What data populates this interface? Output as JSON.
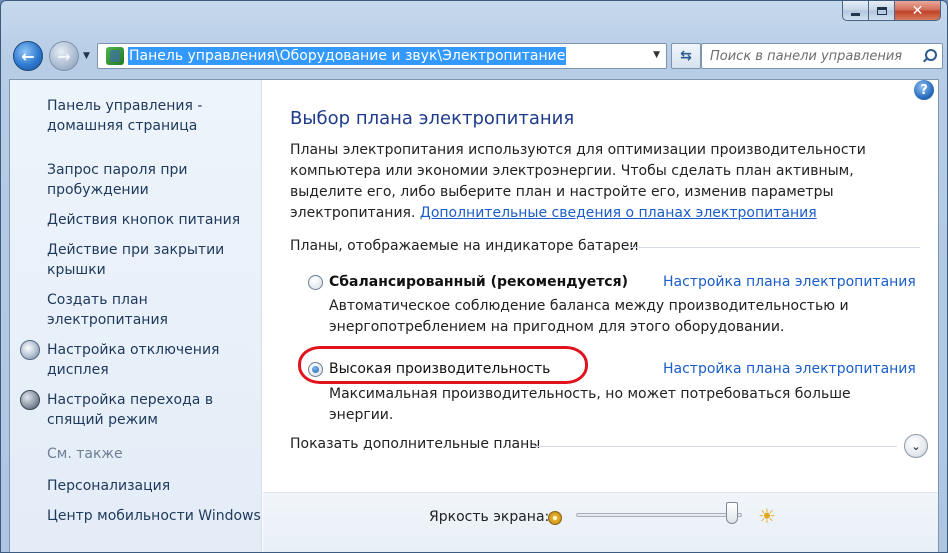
{
  "window": {
    "caption": {
      "minimize": "",
      "maximize": "",
      "close": "✕"
    }
  },
  "navbar": {
    "address": "Панель управления\\Оборудование и звук\\Электропитание",
    "search_placeholder": "Поиск в панели управления"
  },
  "sidebar": {
    "items": [
      {
        "label": "Панель управления - домашняя страница"
      },
      {
        "label": "Запрос пароля при пробуждении"
      },
      {
        "label": "Действия кнопок питания"
      },
      {
        "label": "Действие при закрытии крышки"
      },
      {
        "label": "Создать план электропитания"
      },
      {
        "label": "Настройка отключения дисплея",
        "icon": "monitor-icon"
      },
      {
        "label": "Настройка перехода в спящий режим",
        "icon": "moon-icon"
      }
    ],
    "see_also": "См. также",
    "see_also_items": [
      {
        "label": "Персонализация"
      },
      {
        "label": "Центр мобильности Windows"
      }
    ]
  },
  "main": {
    "help": "?",
    "title": "Выбор плана электропитания",
    "intro_text": "Планы электропитания используются для оптимизации производительности компьютера или экономии электроэнергии. Чтобы сделать план активным, выделите его, либо выберите план и настройте его, изменив параметры электропитания. ",
    "intro_link": "Дополнительные сведения о планах электропитания",
    "section_heading": "Планы, отображаемые на индикаторе батареи",
    "plans": [
      {
        "name": "Сбалансированный (рекомендуется)",
        "selected": false,
        "link": "Настройка плана электропитания",
        "description": "Автоматическое соблюдение баланса между производительностью и энергопотреблением на пригодном для этого оборудовании."
      },
      {
        "name": "Высокая производительность",
        "selected": true,
        "link": "Настройка плана электропитания",
        "description": "Максимальная производительность, но может потребоваться больше энергии."
      }
    ],
    "more_plans": "Показать дополнительные планы",
    "brightness_label": "Яркость экрана:",
    "brightness_level": 0.94
  },
  "colors": {
    "link": "#1a5ec9",
    "title": "#1e3b8b",
    "highlight": "#e1141e",
    "address_selection": "#3399ff"
  }
}
